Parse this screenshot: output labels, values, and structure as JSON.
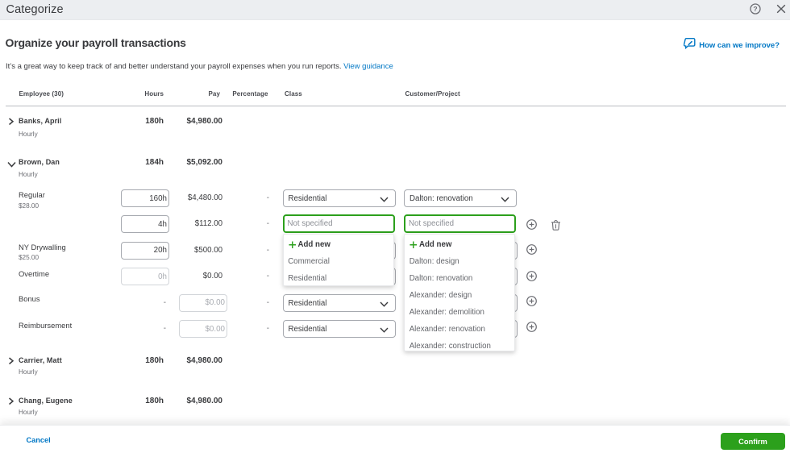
{
  "titlebar": {
    "title": "Categorize"
  },
  "intro": {
    "heading": "Organize your payroll transactions",
    "description": "It’s a great way to keep track of and better understand your payroll expenses when you run reports.",
    "guidance_link": "View guidance",
    "improve_link": "How can we improve?"
  },
  "columns": {
    "employee": "Employee (30)",
    "hours": "Hours",
    "pay": "Pay",
    "percentage": "Percentage",
    "class": "Class",
    "customer": "Customer/Project"
  },
  "employees": {
    "banks": {
      "name": "Banks, April",
      "type": "Hourly",
      "hours": "180h",
      "pay": "$4,980.00"
    },
    "brown": {
      "name": "Brown, Dan",
      "type": "Hourly",
      "hours": "184h",
      "pay": "$5,092.00"
    },
    "carrier": {
      "name": "Carrier, Matt",
      "type": "Hourly",
      "hours": "180h",
      "pay": "$4,980.00"
    },
    "chang": {
      "name": "Chang, Eugene",
      "type": "Hourly",
      "hours": "180h",
      "pay": "$4,980.00"
    }
  },
  "pay_items": {
    "regular": {
      "label": "Regular",
      "rate": "$28.00",
      "hours": "160h",
      "pay": "$4,480.00",
      "percentage": "-",
      "class": "Residential",
      "customer": "Dalton: renovation"
    },
    "split": {
      "hours": "4h",
      "pay": "$112.00",
      "percentage": "-",
      "class_placeholder": "Not specified",
      "customer_placeholder": "Not specified"
    },
    "drywall": {
      "label": "NY Drywalling",
      "rate": "$25.00",
      "hours": "20h",
      "pay": "$500.00",
      "percentage": "-"
    },
    "overtime": {
      "label": "Overtime",
      "hours_placeholder": "0h",
      "pay": "$0.00",
      "percentage": "-"
    },
    "bonus": {
      "label": "Bonus",
      "hours_dash": "-",
      "pay_placeholder": "$0.00",
      "percentage": "-",
      "class": "Residential"
    },
    "reimbursement": {
      "label": "Reimbursement",
      "hours_dash": "-",
      "pay_placeholder": "$0.00",
      "percentage": "-",
      "class": "Residential"
    }
  },
  "class_dropdown": {
    "add_new": "Add new",
    "options": [
      "Commercial",
      "Residential"
    ]
  },
  "customer_dropdown": {
    "add_new": "Add new",
    "options": [
      "Dalton: design",
      "Dalton: renovation",
      "Alexander: design",
      "Alexander: demolition",
      "Alexander: renovation",
      "Alexander: construction"
    ]
  },
  "footer": {
    "cancel_label": "Cancel",
    "confirm_label": "Confirm"
  },
  "colors": {
    "accent_green": "#2ca01c",
    "link_blue": "#0077c5",
    "text_dark": "#393a3d",
    "text_gray": "#6b6c72"
  }
}
